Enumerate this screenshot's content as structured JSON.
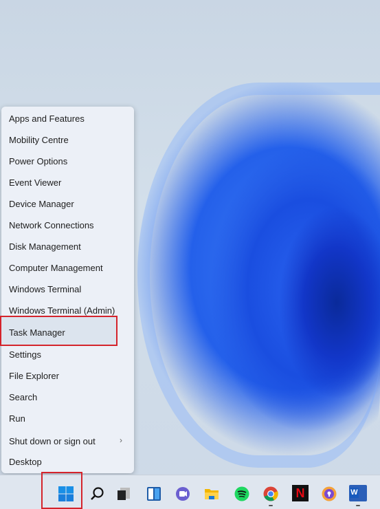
{
  "menu": {
    "items": [
      {
        "label": "Apps and Features"
      },
      {
        "label": "Mobility Centre"
      },
      {
        "label": "Power Options"
      },
      {
        "label": "Event Viewer"
      },
      {
        "label": "Device Manager"
      },
      {
        "label": "Network Connections"
      },
      {
        "label": "Disk Management"
      },
      {
        "label": "Computer Management"
      },
      {
        "label": "Windows Terminal"
      },
      {
        "label": "Windows Terminal (Admin)"
      },
      {
        "label": "Task Manager"
      },
      {
        "label": "Settings"
      },
      {
        "label": "File Explorer"
      },
      {
        "label": "Search"
      },
      {
        "label": "Run"
      },
      {
        "label": "Shut down or sign out"
      },
      {
        "label": "Desktop"
      }
    ],
    "highlighted": "Task Manager",
    "submenu_chevron": "›"
  },
  "taskbar": {
    "icons": [
      "windows-start-icon",
      "search-icon",
      "task-view-icon",
      "widgets-icon",
      "teams-chat-icon",
      "file-explorer-icon",
      "spotify-icon",
      "chrome-icon",
      "netflix-icon",
      "vpn-icon",
      "word-icon"
    ],
    "word_letter": "W",
    "netflix_letter": "N"
  },
  "colors": {
    "highlight": "#d4232b",
    "accent": "#1a6fd8"
  }
}
